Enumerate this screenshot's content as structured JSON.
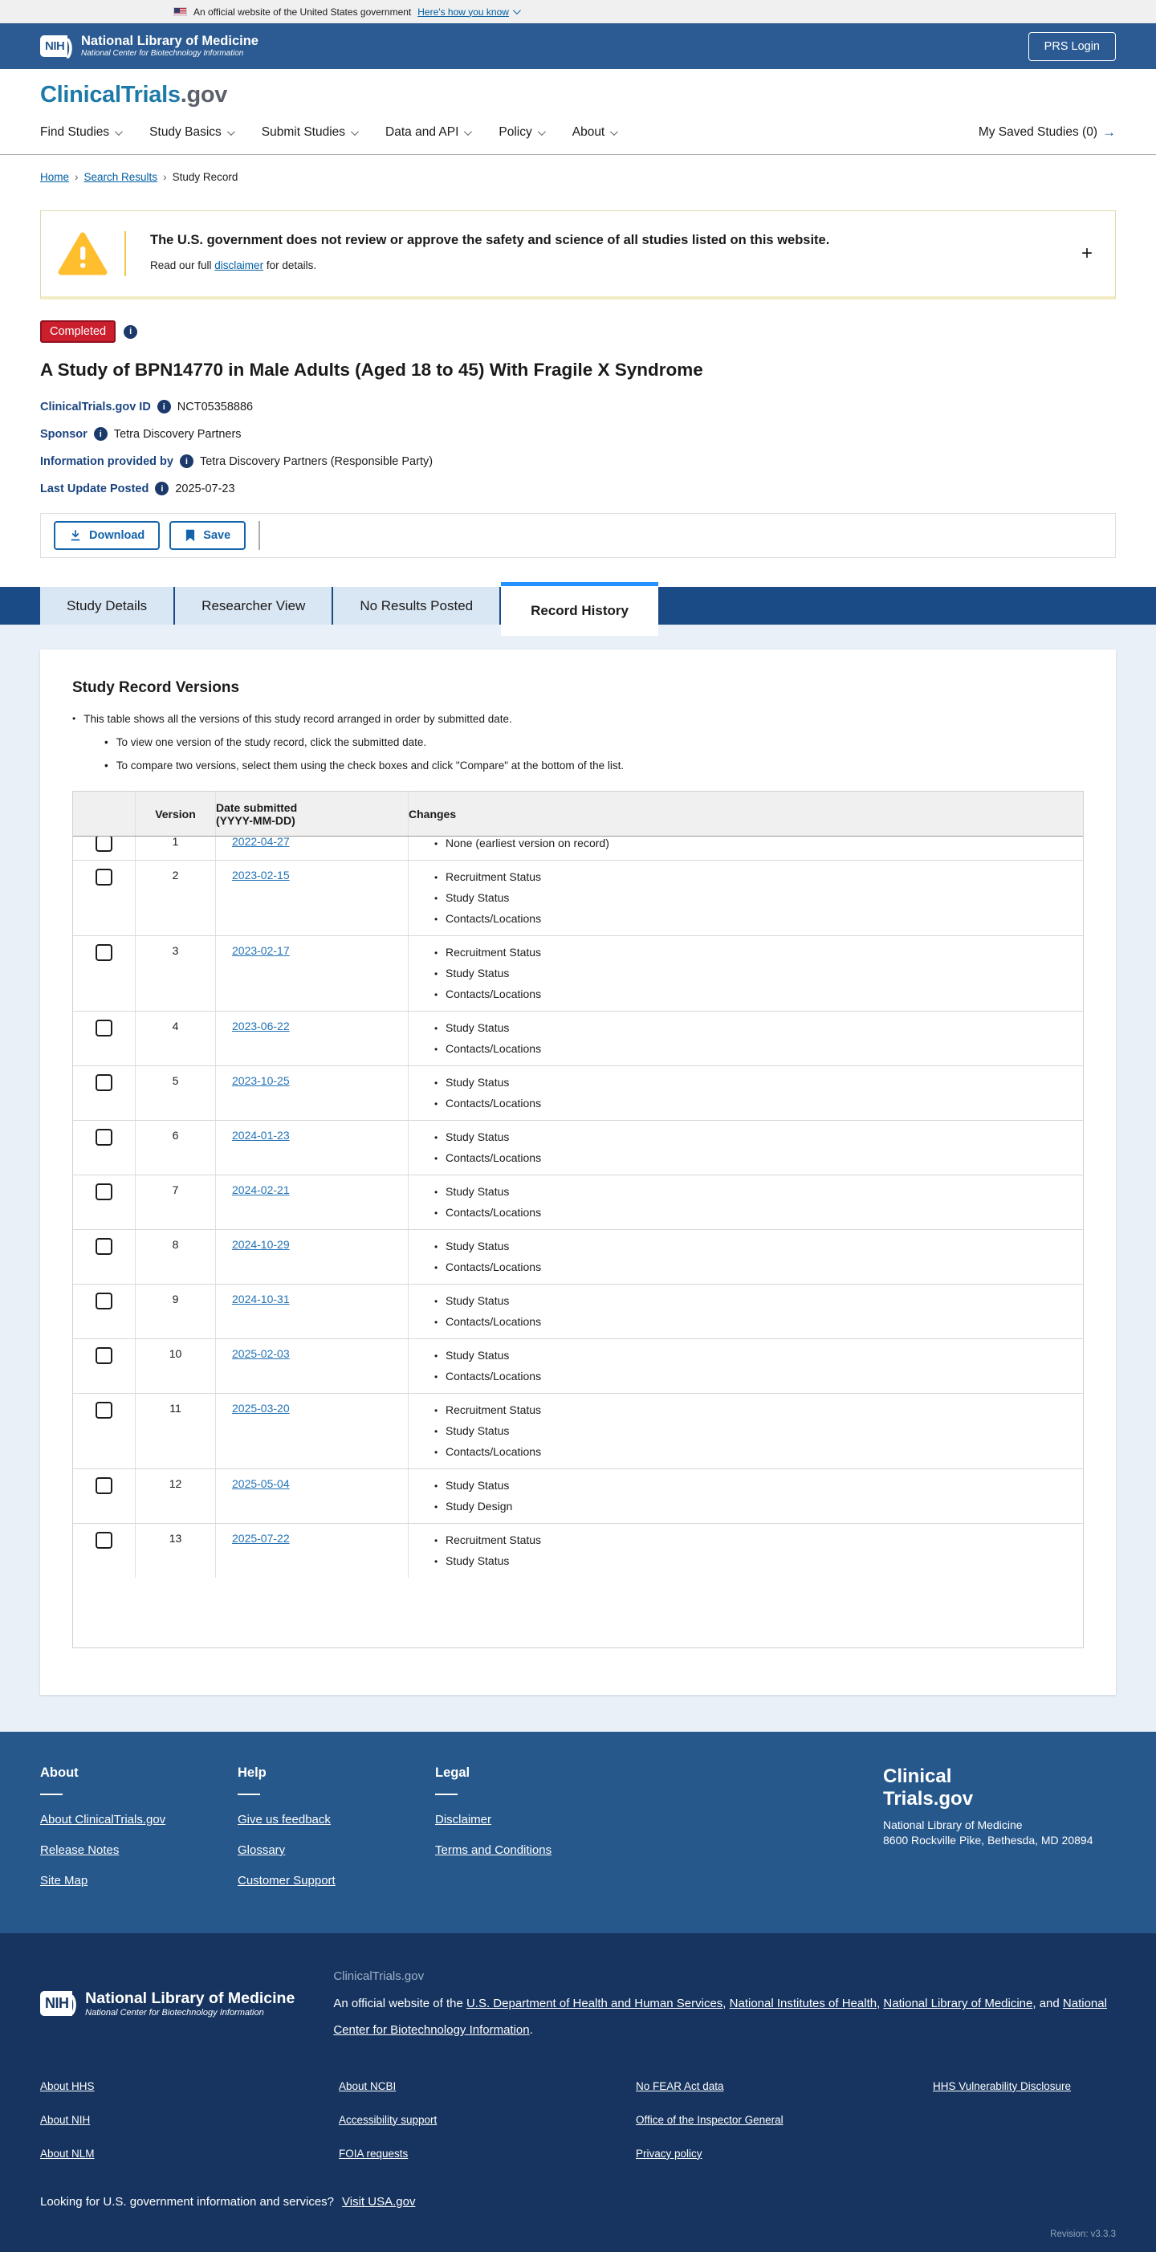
{
  "banner": {
    "official": "An official website of the United States government",
    "how_you_know": "Here's how you know"
  },
  "header": {
    "nih": "NIH",
    "nlm": "National Library of Medicine",
    "ncbi": "National Center for Biotechnology Information",
    "prs_login": "PRS Login"
  },
  "logo": {
    "main": "ClinicalTrials",
    "suffix": ".gov"
  },
  "nav": {
    "items": [
      {
        "label": "Find Studies"
      },
      {
        "label": "Study Basics"
      },
      {
        "label": "Submit Studies"
      },
      {
        "label": "Data and API"
      },
      {
        "label": "Policy"
      },
      {
        "label": "About"
      }
    ],
    "saved_studies": "My Saved Studies (0)",
    "saved_arrow": "→"
  },
  "breadcrumb": {
    "items": [
      "Home",
      "Search Results",
      "Study Record"
    ]
  },
  "warning": {
    "title": "The U.S. government does not review or approve the safety and science of all studies listed on this website.",
    "body_prefix": "Read our full ",
    "link": "disclaimer",
    "body_suffix": " for details.",
    "expand": "+"
  },
  "study": {
    "status": "Completed",
    "title": "A Study of BPN14770 in Male Adults (Aged 18 to 45) With Fragile X Syndrome",
    "fields": [
      {
        "label": "ClinicalTrials.gov ID",
        "value": "NCT05358886"
      },
      {
        "label": "Sponsor",
        "value": "Tetra Discovery Partners"
      },
      {
        "label": "Information provided by",
        "value": "Tetra Discovery Partners (Responsible Party)"
      },
      {
        "label": "Last Update Posted",
        "value": "2025-07-23"
      }
    ],
    "actions": {
      "download": "Download",
      "save": "Save"
    }
  },
  "tabs": [
    {
      "label": "Study Details",
      "active": false
    },
    {
      "label": "Researcher View",
      "active": false
    },
    {
      "label": "No Results Posted",
      "active": false
    },
    {
      "label": "Record History",
      "active": true
    }
  ],
  "record_history": {
    "heading": "Study Record Versions",
    "note_main": "This table shows all the versions of this study record arranged in order by submitted date.",
    "note_subs": [
      "To view one version of the study record, click the submitted date.",
      "To compare two versions, select them using the check boxes and click \"Compare\" at the bottom of the list."
    ],
    "table": {
      "header_version": "Version",
      "header_date_line1": "Date submitted",
      "header_date_line2": "(YYYY-MM-DD)",
      "header_changes": "Changes",
      "rows": [
        {
          "version": "1",
          "date": "2022-04-27",
          "changes": [
            "None (earliest version on record)"
          ]
        },
        {
          "version": "2",
          "date": "2023-02-15",
          "changes": [
            "Recruitment Status",
            "Study Status",
            "Contacts/Locations"
          ]
        },
        {
          "version": "3",
          "date": "2023-02-17",
          "changes": [
            "Recruitment Status",
            "Study Status",
            "Contacts/Locations"
          ]
        },
        {
          "version": "4",
          "date": "2023-06-22",
          "changes": [
            "Study Status",
            "Contacts/Locations"
          ]
        },
        {
          "version": "5",
          "date": "2023-10-25",
          "changes": [
            "Study Status",
            "Contacts/Locations"
          ]
        },
        {
          "version": "6",
          "date": "2024-01-23",
          "changes": [
            "Study Status",
            "Contacts/Locations"
          ]
        },
        {
          "version": "7",
          "date": "2024-02-21",
          "changes": [
            "Study Status",
            "Contacts/Locations"
          ]
        },
        {
          "version": "8",
          "date": "2024-10-29",
          "changes": [
            "Study Status",
            "Contacts/Locations"
          ]
        },
        {
          "version": "9",
          "date": "2024-10-31",
          "changes": [
            "Study Status",
            "Contacts/Locations"
          ]
        },
        {
          "version": "10",
          "date": "2025-02-03",
          "changes": [
            "Study Status",
            "Contacts/Locations"
          ]
        },
        {
          "version": "11",
          "date": "2025-03-20",
          "changes": [
            "Recruitment Status",
            "Study Status",
            "Contacts/Locations"
          ]
        },
        {
          "version": "12",
          "date": "2025-05-04",
          "changes": [
            "Study Status",
            "Study Design"
          ]
        },
        {
          "version": "13",
          "date": "2025-07-22",
          "changes": [
            "Recruitment Status",
            "Study Status"
          ]
        }
      ]
    }
  },
  "footer": {
    "columns": [
      {
        "heading": "About",
        "links": [
          "About ClinicalTrials.gov",
          "Release Notes",
          "Site Map"
        ]
      },
      {
        "heading": "Help",
        "links": [
          "Give us feedback",
          "Glossary",
          "Customer Support"
        ]
      },
      {
        "heading": "Legal",
        "links": [
          "Disclaimer",
          "Terms and Conditions"
        ]
      }
    ],
    "brand": {
      "line1": "Clinical",
      "line2": "Trials.gov",
      "org": "National Library of Medicine",
      "address": "8600 Rockville Pike, Bethesda, MD 20894"
    }
  },
  "subfooter": {
    "nih": "NIH",
    "nlm": "National Library of Medicine",
    "ncbi": "National Center for Biotechnology Information",
    "ct_label": "ClinicalTrials.gov",
    "official_segments": [
      {
        "text": "An official website of the "
      },
      {
        "link": "U.S. Department of Health and Human Services"
      },
      {
        "text": ", "
      },
      {
        "link": "National Institutes of Health"
      },
      {
        "text": ", "
      },
      {
        "link": "National Library of Medicine"
      },
      {
        "text": ", and "
      },
      {
        "link": "National Center for Biotechnology Information"
      },
      {
        "text": "."
      }
    ],
    "links_grid": [
      [
        "About HHS",
        "About NCBI",
        "No FEAR Act data",
        "HHS Vulnerability Disclosure"
      ],
      [
        "About NIH",
        "Accessibility support",
        "Office of the Inspector General",
        ""
      ],
      [
        "About NLM",
        "FOIA requests",
        "Privacy policy",
        ""
      ]
    ],
    "usa_text": "Looking for U.S. government information and services?",
    "usa_link": "Visit USA.gov",
    "revision": "Revision: v3.3.3"
  },
  "colors": {
    "header_blue": "#2b5b92",
    "tab_bar_blue": "#1b4b87",
    "active_tab_accent": "#2491ff",
    "badge_red": "#cb1f2e",
    "link_blue": "#005ea2",
    "date_link_blue": "#2272b5",
    "footer_blue": "#27588c",
    "footer_dark_blue": "#16345f",
    "warning_yellow": "#ffbe2e",
    "section_bg": "#e9f0f7"
  }
}
